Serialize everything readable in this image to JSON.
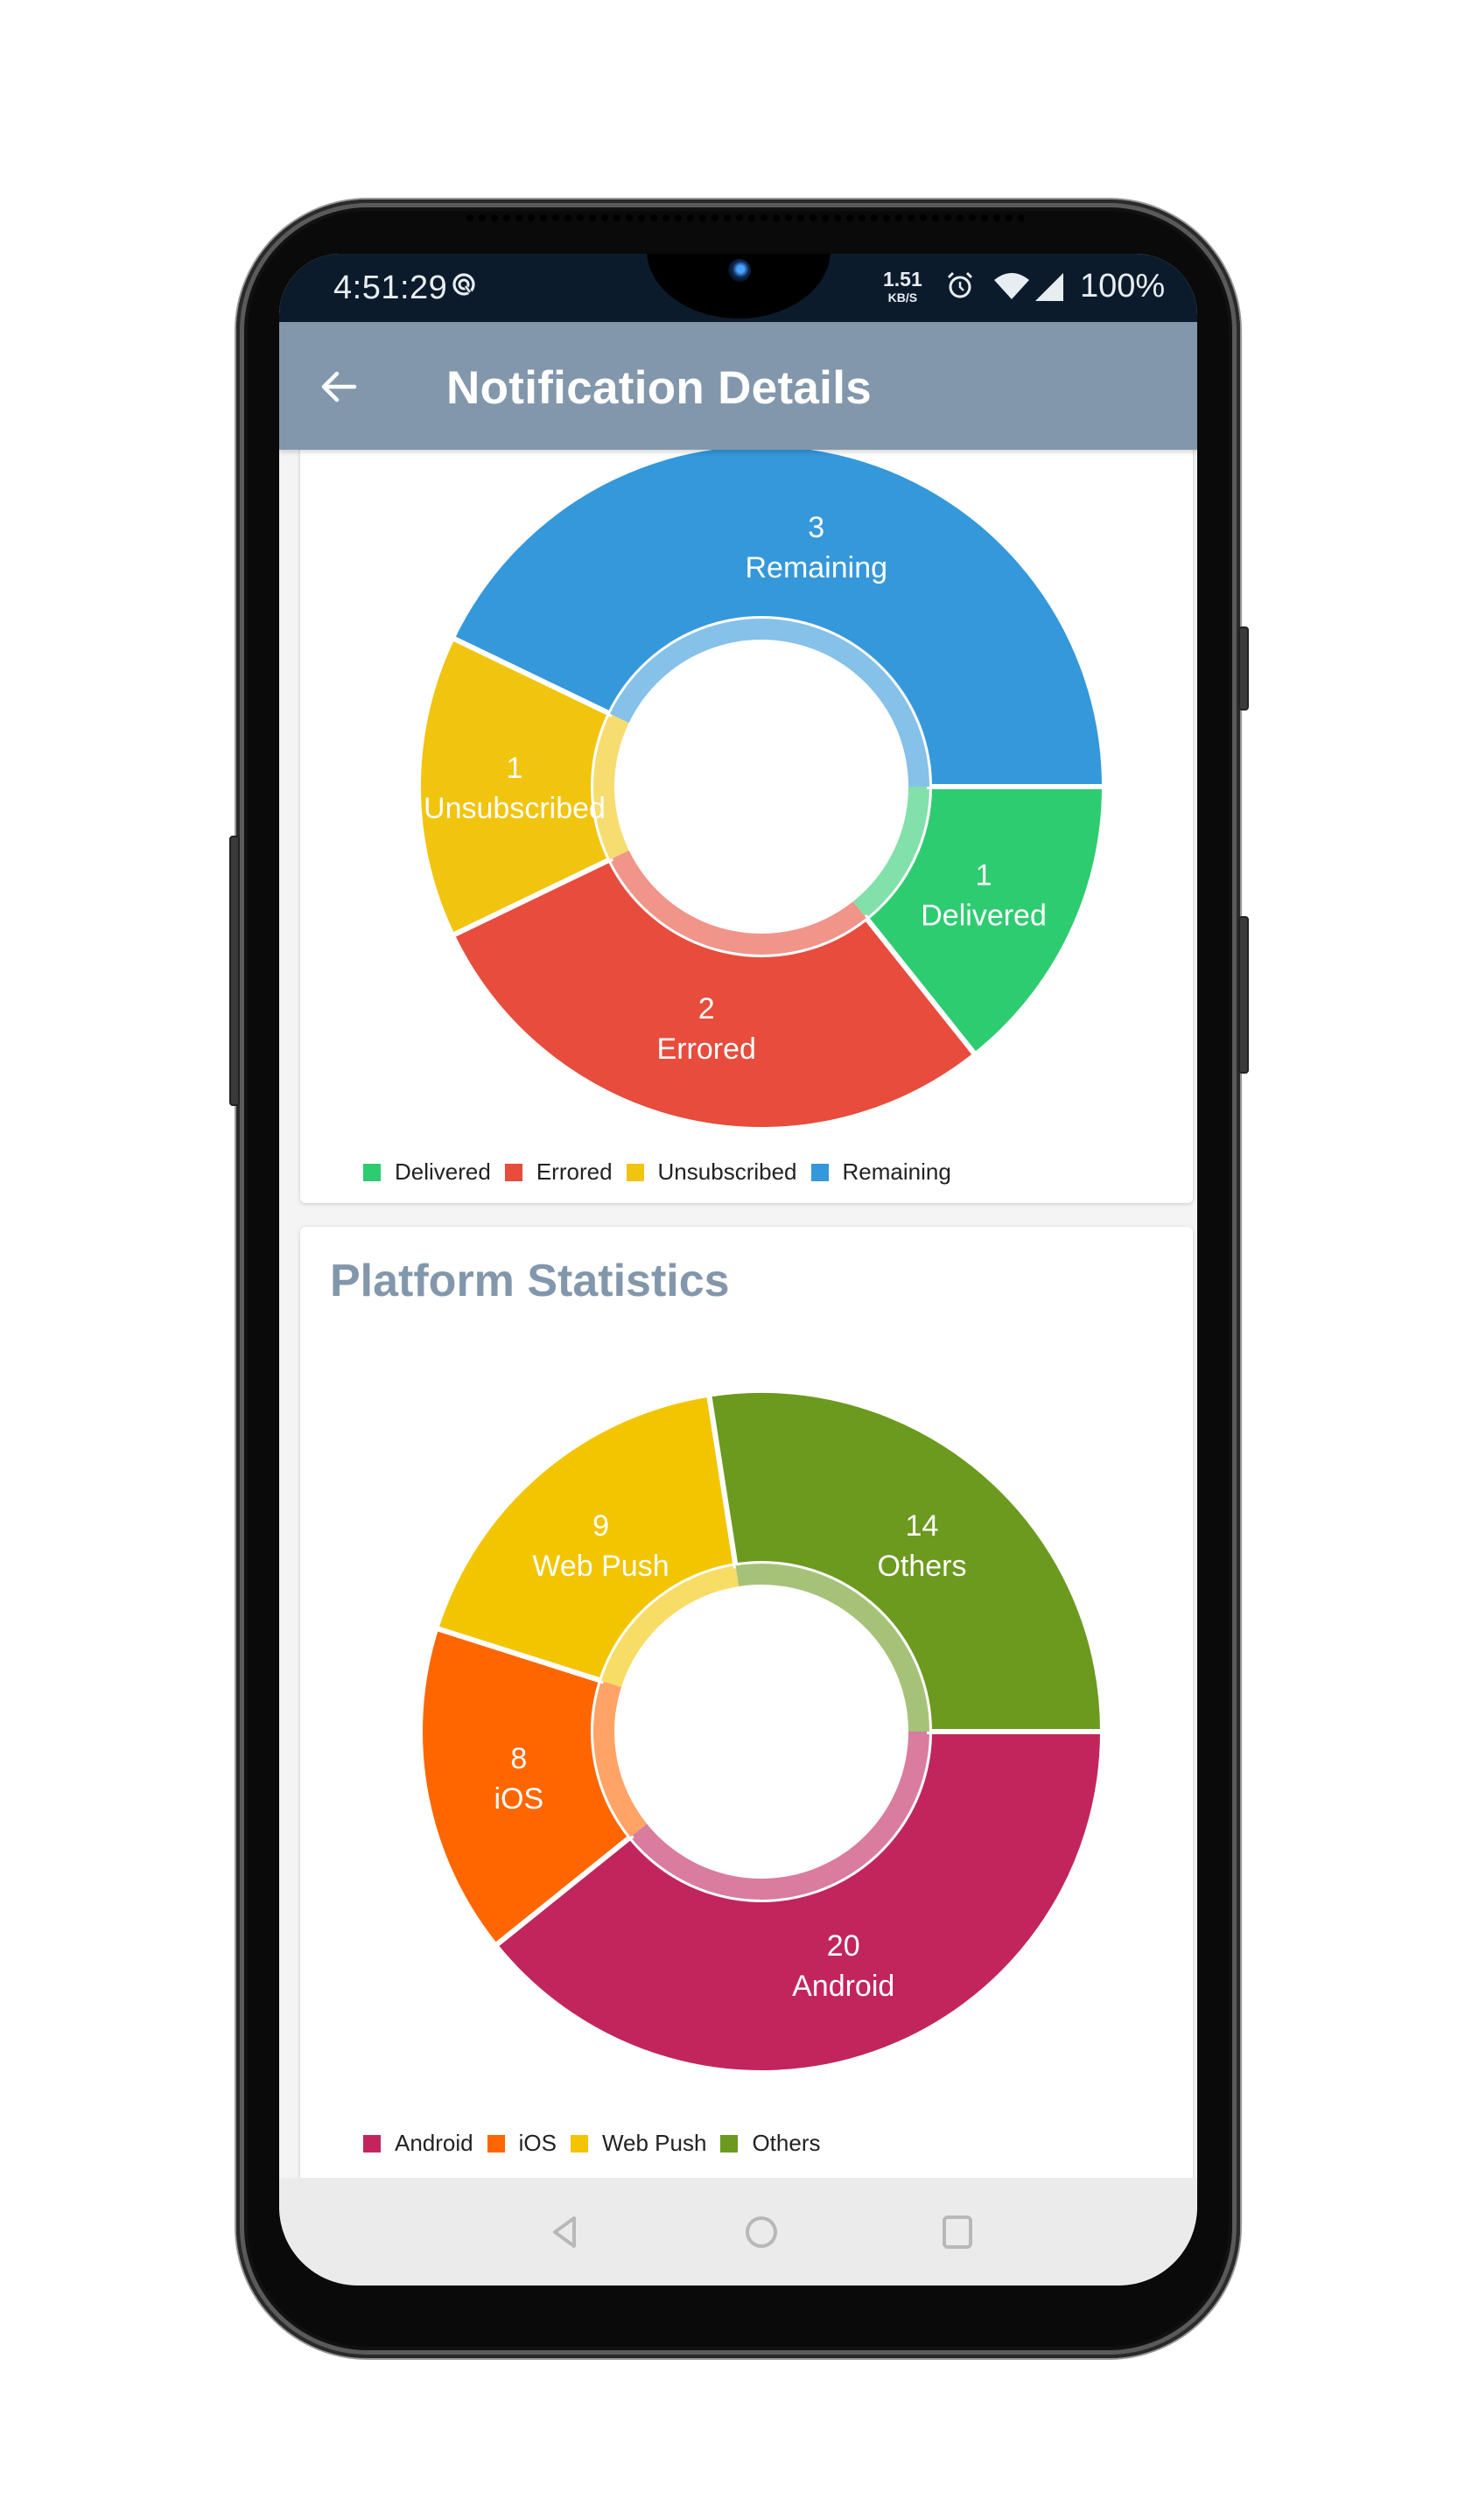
{
  "status_bar": {
    "time": "4:51:29",
    "sync_icon": "data-saver-icon",
    "net_speed_value": "1.51",
    "net_speed_unit": "KB/S",
    "alarm_icon": "alarm-icon",
    "wifi_icon": "wifi-icon",
    "signal_icon": "cellular-signal-icon",
    "battery": "100%"
  },
  "app_bar": {
    "back_icon": "arrow-left-icon",
    "title": "Notification Details"
  },
  "cards": [
    {
      "title": "",
      "legend_position": "bottom-left"
    },
    {
      "title": "Platform Statistics",
      "legend_position": "bottom-left"
    }
  ],
  "nav_bar": {
    "back": "nav-back-icon",
    "home": "nav-home-icon",
    "recents": "nav-recents-icon"
  },
  "chart_data": [
    {
      "type": "pie",
      "variant": "donut",
      "title": "",
      "start_angle_deg": 0,
      "direction": "clockwise",
      "categories": [
        "Delivered",
        "Errored",
        "Unsubscribed",
        "Remaining"
      ],
      "values": [
        1,
        2,
        1,
        3
      ],
      "colors": [
        "#2ecc71",
        "#e74c3c",
        "#f1c40f",
        "#3498db"
      ],
      "labels": [
        {
          "value": "1",
          "name": "Delivered"
        },
        {
          "value": "2",
          "name": "Errored"
        },
        {
          "value": "1",
          "name": "Unsubscribed"
        },
        {
          "value": "3",
          "name": "Remaining"
        }
      ],
      "legend": [
        "Delivered",
        "Errored",
        "Unsubscribed",
        "Remaining"
      ]
    },
    {
      "type": "pie",
      "variant": "donut",
      "title": "Platform Statistics",
      "start_angle_deg": 0,
      "direction": "clockwise",
      "categories": [
        "Android",
        "iOS",
        "Web Push",
        "Others"
      ],
      "values": [
        20,
        8,
        9,
        14
      ],
      "colors": [
        "#c2255c",
        "#ff6600",
        "#f2c500",
        "#6b9a1f"
      ],
      "labels": [
        {
          "value": "20",
          "name": "Android"
        },
        {
          "value": "8",
          "name": "iOS"
        },
        {
          "value": "9",
          "name": "Web Push"
        },
        {
          "value": "14",
          "name": "Others"
        }
      ],
      "legend": [
        "Android",
        "iOS",
        "Web Push",
        "Others"
      ]
    }
  ]
}
